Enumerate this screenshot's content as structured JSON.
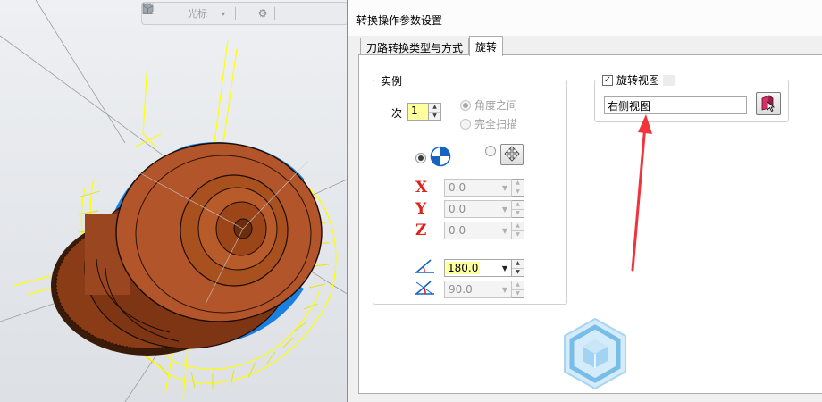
{
  "toolbar": {
    "cursor_label": "光标",
    "icons": [
      "lock-icon",
      "select-mode-icon",
      "chevron-down-icon",
      "snap-icon",
      "gear-icon",
      "pointer-icon",
      "layers-icon",
      "cube-icon"
    ]
  },
  "dialog": {
    "title": "转换操作参数设置",
    "tabs": [
      {
        "label": "刀路转换类型与方式",
        "active": false
      },
      {
        "label": "旋转",
        "active": true
      }
    ],
    "instance_group": {
      "legend": "实例",
      "count_label": "次",
      "count_value": "1",
      "mode_options": [
        {
          "label": "角度之间",
          "checked": true
        },
        {
          "label": "完全扫描",
          "checked": false
        }
      ],
      "x_value": "0.0",
      "y_value": "0.0",
      "z_value": "0.0",
      "start_angle_value": "180.0",
      "sweep_angle_value": "90.0",
      "axis_letters": {
        "x": "X",
        "y": "Y",
        "z": "Z"
      }
    },
    "rotate_view_group": {
      "checkbox_label": "旋转视图",
      "checked": true,
      "view_name": "右侧视图"
    }
  },
  "colors": {
    "highlight_field": "#ffff9b",
    "axis_letter": "#d9251c",
    "arrow_annotation": "#f0343c",
    "part_body": "#b2552a",
    "toolpath_yellow": "#ffff00",
    "toolpath_blue": "#1a7fe0"
  }
}
